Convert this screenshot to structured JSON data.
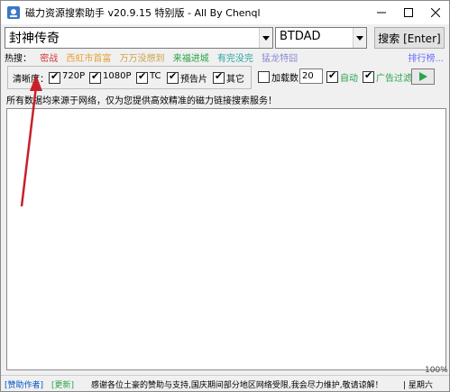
{
  "window": {
    "title": "磁力资源搜索助手 v20.9.15 特别版 - All By Chenql"
  },
  "search": {
    "value": "封神传奇",
    "site": "BTDAD",
    "button_label": "搜索 [Enter]"
  },
  "hot": {
    "label": "热搜：",
    "items": [
      {
        "text": "密战",
        "color": "#d43a3a"
      },
      {
        "text": "西虹市首富",
        "color": "#e8a13a"
      },
      {
        "text": "万万没想到",
        "color": "#c9a54a"
      },
      {
        "text": "来福进城",
        "color": "#2aa34a"
      },
      {
        "text": "有完没完",
        "color": "#2aa3a3"
      },
      {
        "text": "猛龙特囧",
        "color": "#8a8ad4"
      }
    ],
    "rank_link": "排行榜..."
  },
  "filters": {
    "label": "清晰度：",
    "options": [
      {
        "label": "720P",
        "checked": true
      },
      {
        "label": "1080P",
        "checked": true
      },
      {
        "label": "TC",
        "checked": true
      },
      {
        "label": "预告片",
        "checked": true
      },
      {
        "label": "其它",
        "checked": true
      }
    ]
  },
  "options": {
    "load_count_label": "加载数",
    "load_count_checked": false,
    "load_count_value": "20",
    "auto_label": "自动",
    "auto_checked": true,
    "ad_filter_label": "广告过滤",
    "ad_filter_checked": true
  },
  "notice": "所有数据均来源于网络，仅为您提供高效精准的磁力链接搜索服务！",
  "status": {
    "sponsor": "[赞助作者]",
    "update": "[更新]",
    "message": "感谢各位土豪的赞助与支持,国庆期间部分地区网络受限,我会尽力维护,敬请谅解！",
    "day": "| 星期六",
    "progress": "100%"
  },
  "colors": {
    "accent_green": "#2aa34a",
    "link_blue": "#0055cc",
    "arrow_red": "#c8202a"
  }
}
